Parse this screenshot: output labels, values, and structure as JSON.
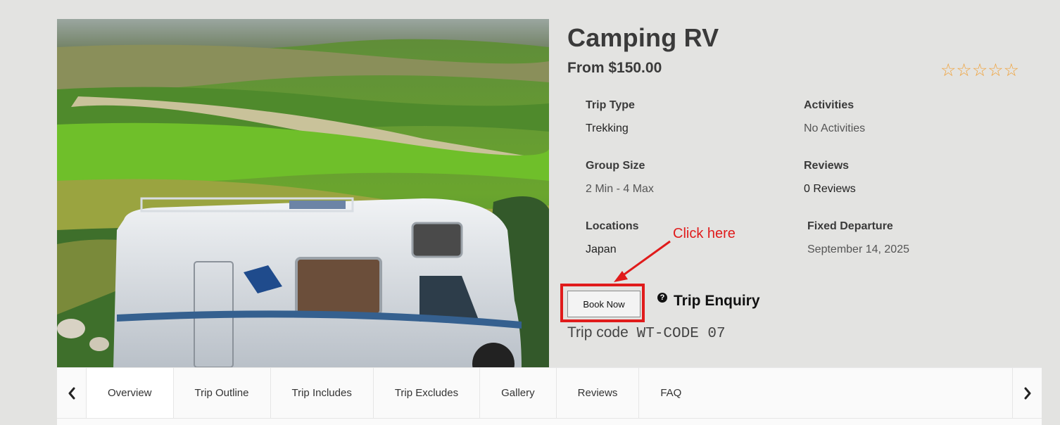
{
  "trip": {
    "title": "Camping RV",
    "price": "From $150.00",
    "rating_stars": "☆☆☆☆☆"
  },
  "facts": {
    "trip_type": {
      "label": "Trip Type",
      "value": "Trekking"
    },
    "activities": {
      "label": "Activities",
      "value": "No Activities"
    },
    "group_size": {
      "label": "Group Size",
      "value": "2 Min - 4 Max"
    },
    "reviews": {
      "label": "Reviews",
      "value": "0 Reviews"
    },
    "locations": {
      "label": "Locations",
      "value": "Japan"
    },
    "fixed_departure": {
      "label": "Fixed Departure",
      "value": "September 14, 2025"
    }
  },
  "annotation": {
    "text": "Click here",
    "color": "#e01b1b"
  },
  "actions": {
    "book_now": "Book Now",
    "enquiry_icon": "?",
    "trip_enquiry": "Trip Enquiry"
  },
  "trip_code": {
    "label": "Trip code",
    "value": "WT-CODE 07"
  },
  "tabs": [
    "Overview",
    "Trip Outline",
    "Trip Includes",
    "Trip Excludes",
    "Gallery",
    "Reviews",
    "FAQ"
  ],
  "icons": {
    "left": "chevron-left-icon",
    "right": "chevron-right-icon",
    "star": "star-outline-icon"
  }
}
